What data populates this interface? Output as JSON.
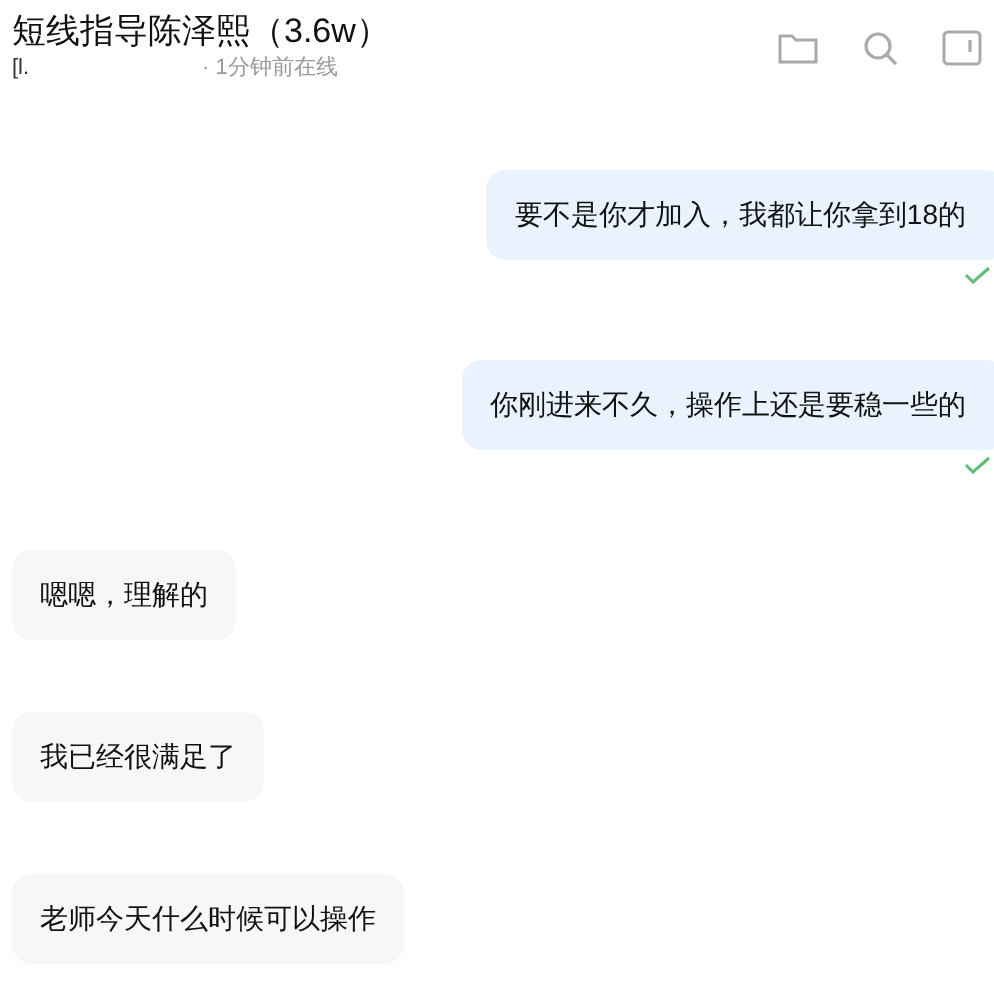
{
  "header": {
    "title": "短线指导陈泽熙（3.6w）",
    "subtitle_prefix": "[l.",
    "status": "· 1分钟前在线"
  },
  "messages": [
    {
      "kind": "sent",
      "text": "要不是你才加入，我都让你拿到18的",
      "read": true
    },
    {
      "kind": "sent",
      "text": "你刚进来不久，操作上还是要稳一些的",
      "read": true
    },
    {
      "kind": "received",
      "text": "嗯嗯，理解的"
    },
    {
      "kind": "received",
      "text": "我已经很满足了"
    },
    {
      "kind": "received",
      "text": "老师今天什么时候可以操作"
    }
  ]
}
